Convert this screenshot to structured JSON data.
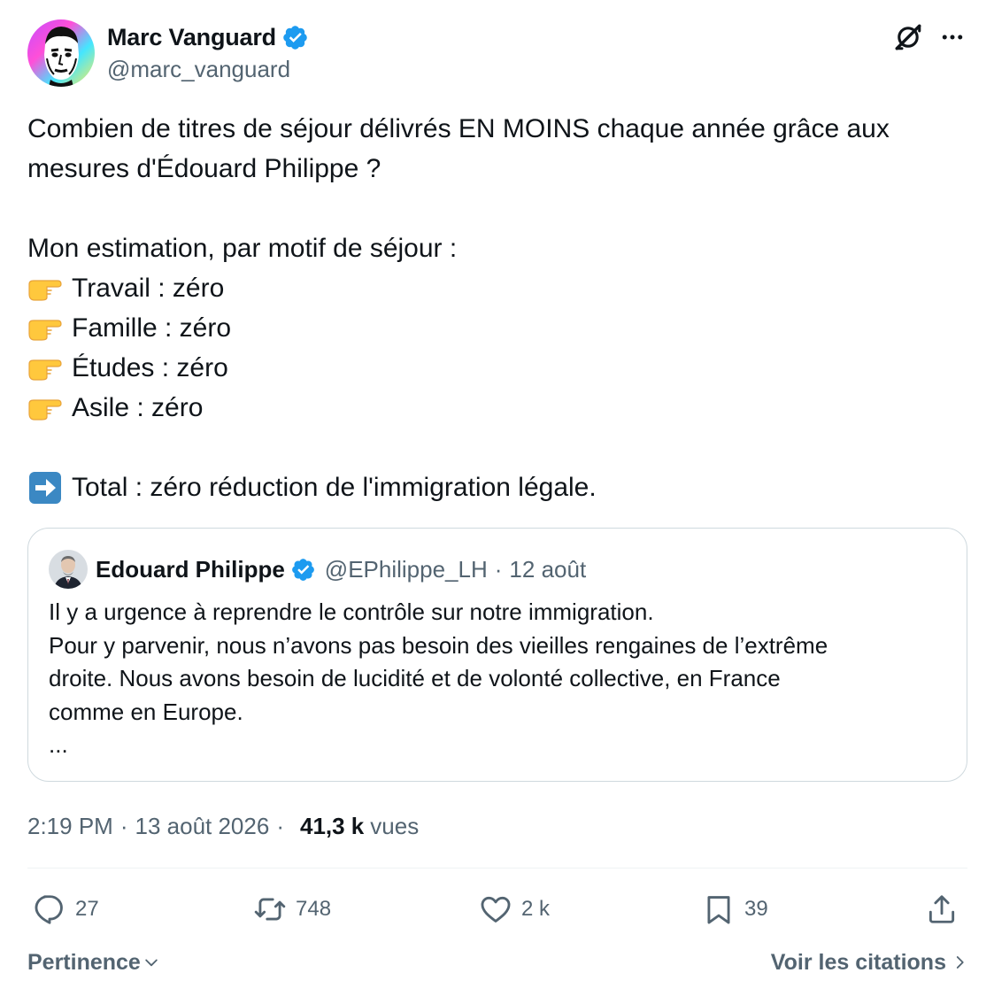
{
  "author": {
    "name": "Marc Vanguard",
    "handle": "@marc_vanguard",
    "verified": true
  },
  "icons": {
    "verified": "verified-badge-icon",
    "grok": "grok-icon",
    "more": "more-options-icon",
    "point_right": "pointing-right-emoji",
    "arrow_right": "right-arrow-emoji",
    "reply": "reply-icon",
    "repost": "repost-icon",
    "like": "like-icon",
    "bookmark": "bookmark-icon",
    "share": "share-icon",
    "chevron_down": "chevron-down-icon",
    "chevron_right": "chevron-right-icon"
  },
  "colors": {
    "verified_blue": "#1d9bf0",
    "secondary_text": "#536471",
    "primary_text": "#0f1419",
    "border": "#cfd9de"
  },
  "tweet": {
    "line1": "Combien de titres de séjour délivrés EN MOINS chaque année grâce aux",
    "line2": "mesures d'Édouard Philippe ?",
    "intro": "Mon estimation, par motif de séjour :",
    "items": [
      "Travail : zéro",
      "Famille : zéro",
      "Études : zéro",
      "Asile : zéro"
    ],
    "total": "Total : zéro réduction de l'immigration légale."
  },
  "quote": {
    "name": "Edouard Philippe",
    "handle": "@EPhilippe_LH",
    "separator": "·",
    "date": "12 août",
    "lines": [
      "Il y a urgence à reprendre le contrôle sur notre immigration.",
      "Pour y parvenir, nous n’avons pas besoin des vieilles rengaines de l’extrême",
      "droite. Nous avons besoin de lucidité et de volonté collective, en France",
      "comme en Europe.",
      "..."
    ]
  },
  "meta": {
    "time": "2:19 PM",
    "separator": "·",
    "date": "13 août 2026",
    "views_count": "41,3 k",
    "views_label": "vues"
  },
  "actions": {
    "replies": "27",
    "reposts": "748",
    "likes": "2 k",
    "bookmarks": "39"
  },
  "footer": {
    "sort_label": "Pertinence",
    "quotes_label": "Voir les citations"
  }
}
